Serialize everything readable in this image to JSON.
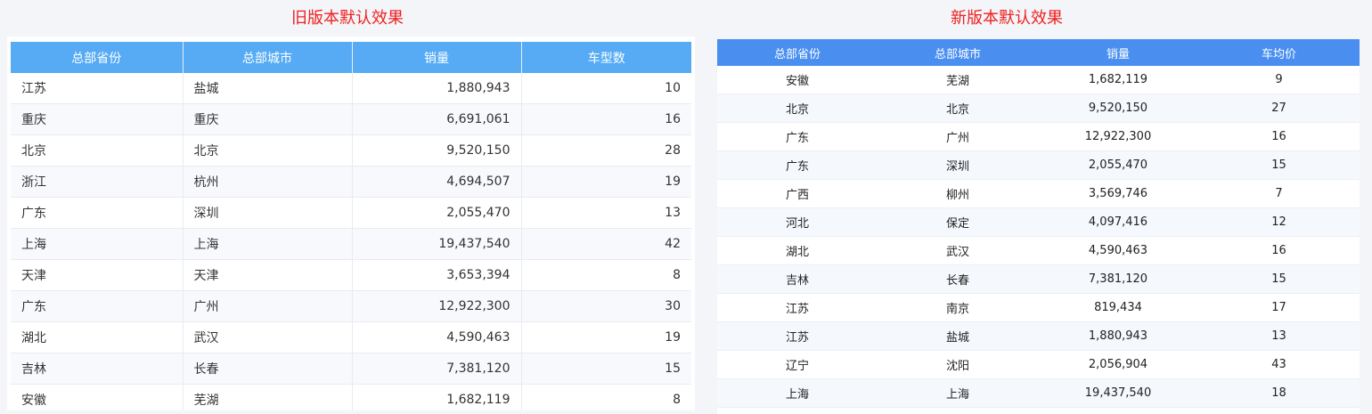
{
  "old_panel": {
    "title": "旧版本默认效果",
    "headers": [
      "总部省份",
      "总部城市",
      "销量",
      "车型数"
    ],
    "rows": [
      [
        "江苏",
        "盐城",
        "1,880,943",
        "10"
      ],
      [
        "重庆",
        "重庆",
        "6,691,061",
        "16"
      ],
      [
        "北京",
        "北京",
        "9,520,150",
        "28"
      ],
      [
        "浙江",
        "杭州",
        "4,694,507",
        "19"
      ],
      [
        "广东",
        "深圳",
        "2,055,470",
        "13"
      ],
      [
        "上海",
        "上海",
        "19,437,540",
        "42"
      ],
      [
        "天津",
        "天津",
        "3,653,394",
        "8"
      ],
      [
        "广东",
        "广州",
        "12,922,300",
        "30"
      ],
      [
        "湖北",
        "武汉",
        "4,590,463",
        "19"
      ],
      [
        "吉林",
        "长春",
        "7,381,120",
        "15"
      ],
      [
        "安徽",
        "芜湖",
        "1,682,119",
        "8"
      ]
    ]
  },
  "new_panel": {
    "title": "新版本默认效果",
    "headers": [
      "总部省份",
      "总部城市",
      "销量",
      "车均价"
    ],
    "rows": [
      [
        "安徽",
        "芜湖",
        "1,682,119",
        "9"
      ],
      [
        "北京",
        "北京",
        "9,520,150",
        "27"
      ],
      [
        "广东",
        "广州",
        "12,922,300",
        "16"
      ],
      [
        "广东",
        "深圳",
        "2,055,470",
        "15"
      ],
      [
        "广西",
        "柳州",
        "3,569,746",
        "7"
      ],
      [
        "河北",
        "保定",
        "4,097,416",
        "12"
      ],
      [
        "湖北",
        "武汉",
        "4,590,463",
        "16"
      ],
      [
        "吉林",
        "长春",
        "7,381,120",
        "15"
      ],
      [
        "江苏",
        "南京",
        "819,434",
        "17"
      ],
      [
        "江苏",
        "盐城",
        "1,880,943",
        "13"
      ],
      [
        "辽宁",
        "沈阳",
        "2,056,904",
        "43"
      ],
      [
        "上海",
        "上海",
        "19,437,540",
        "18"
      ]
    ]
  }
}
